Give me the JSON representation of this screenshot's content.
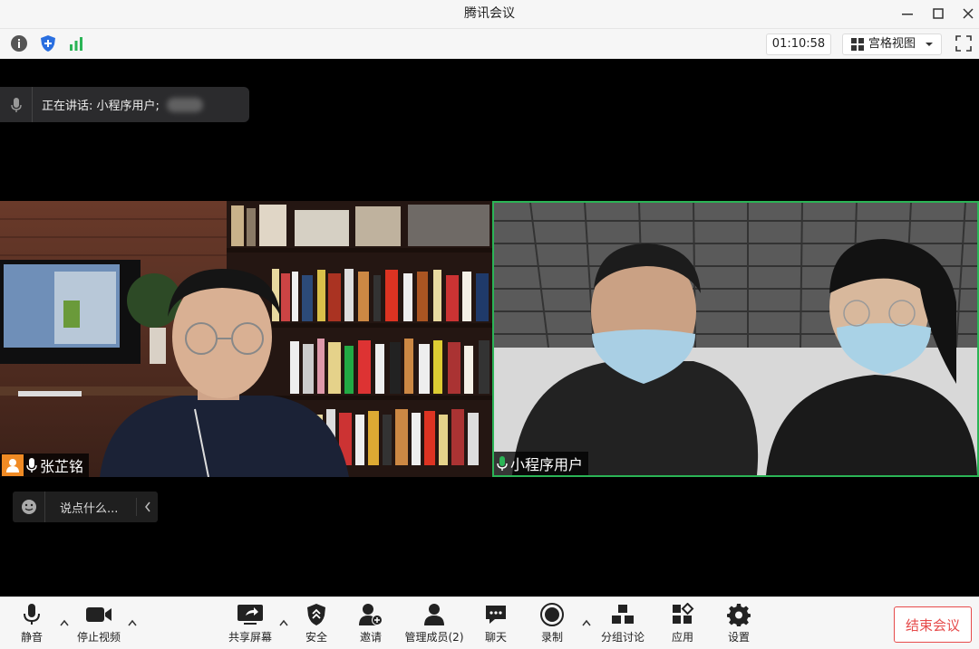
{
  "window": {
    "title": "腾讯会议"
  },
  "infobar": {
    "timer": "01:10:58",
    "view_label": "宫格视图"
  },
  "speaking": {
    "text": "正在讲话: 小程序用户;"
  },
  "participants": [
    {
      "name": "张芷铭"
    },
    {
      "name": "小程序用户"
    }
  ],
  "chat": {
    "placeholder": "说点什么..."
  },
  "toolbar": {
    "mute": "静音",
    "stop_video": "停止视频",
    "share_screen": "共享屏幕",
    "security": "安全",
    "invite": "邀请",
    "manage_members": "管理成员(2)",
    "chat": "聊天",
    "record": "录制",
    "breakout": "分组讨论",
    "apps": "应用",
    "settings": "设置",
    "end_meeting": "结束会议"
  },
  "colors": {
    "accent_green": "#2bb456",
    "end_red": "#e64b4b",
    "badge_orange": "#f08a24",
    "shield_blue": "#2a6fe0"
  }
}
